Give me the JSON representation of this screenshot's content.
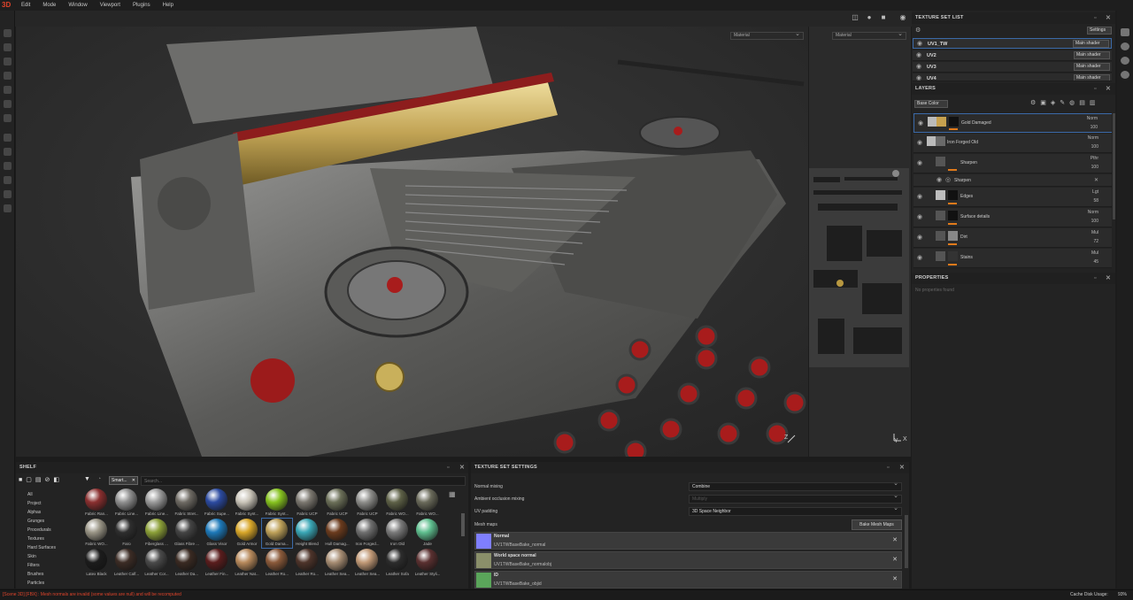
{
  "app": {
    "logo": "3D"
  },
  "menu": [
    "Edit",
    "Mode",
    "Window",
    "Viewport",
    "Plugins",
    "Help"
  ],
  "viewport": {
    "left_dropdown": "Material",
    "right_dropdown": "Material",
    "axis_z": "Z",
    "axis_y": "Y",
    "axis_x": "X"
  },
  "texture_set_list": {
    "title": "TEXTURE SET LIST",
    "settings_label": "Settings",
    "rows": [
      {
        "name": "UV1_TW",
        "shader": "Main shader"
      },
      {
        "name": "UV2",
        "shader": "Main shader"
      },
      {
        "name": "UV3",
        "shader": "Main shader"
      },
      {
        "name": "UV4",
        "shader": "Main shader"
      }
    ]
  },
  "layers": {
    "title": "LAYERS",
    "channel": "Base Color",
    "rows": [
      {
        "name": "Gold Damaged",
        "blend": "Norm",
        "opacity": "100"
      },
      {
        "name": "Iron Forged Old",
        "blend": "Norm",
        "opacity": "100"
      },
      {
        "name": "Sharpen",
        "blend": "Pthr",
        "opacity": "100"
      },
      {
        "name": "Sharpen",
        "blend": "",
        "opacity": ""
      },
      {
        "name": "Edges",
        "blend": "Lgt",
        "opacity": "58"
      },
      {
        "name": "Surface details",
        "blend": "Norm",
        "opacity": "100"
      },
      {
        "name": "Dirt",
        "blend": "Mul",
        "opacity": "72"
      },
      {
        "name": "Stains",
        "blend": "Mul",
        "opacity": "45"
      }
    ]
  },
  "properties": {
    "title": "PROPERTIES",
    "empty_text": "No properties found"
  },
  "shelf": {
    "title": "SHELF",
    "filter_tag": "Smart...",
    "search_placeholder": "Search...",
    "categories": [
      "All",
      "Project",
      "Alphas",
      "Grunges",
      "Procedurals",
      "Textures",
      "Hard Surfaces",
      "Skin",
      "Filters",
      "Brushes",
      "Particles"
    ],
    "materials": [
      {
        "label": "Fabric Ran...",
        "color": "#8a2f2f"
      },
      {
        "label": "Fabric Line...",
        "color": "#8f8f8f"
      },
      {
        "label": "Fabric Line...",
        "color": "#9a9a9a"
      },
      {
        "label": "Fabric Stret...",
        "color": "#6e6a63"
      },
      {
        "label": "Fabric Supe...",
        "color": "#2b4aa0"
      },
      {
        "label": "Fabric Synt...",
        "color": "#c9c4b8"
      },
      {
        "label": "Fabric Synt...",
        "color": "#86c21f"
      },
      {
        "label": "Fabric UCP",
        "color": "#7b776f"
      },
      {
        "label": "Fabric UCP",
        "color": "#6b6f58"
      },
      {
        "label": "Fabric UCP",
        "color": "#8d8d8a"
      },
      {
        "label": "Fabric WO...",
        "color": "#5e6147"
      },
      {
        "label": "Fabric WO...",
        "color": "#6a6a5a"
      },
      {
        "label": "Fabric WO...",
        "color": "#9a9586"
      },
      {
        "label": "Faro",
        "color": "#2e2e2e"
      },
      {
        "label": "Fiberglass ...",
        "color": "#8ca038"
      },
      {
        "label": "Glass Fibre ...",
        "color": "#444444"
      },
      {
        "label": "Glass Visor",
        "color": "#1d79b9"
      },
      {
        "label": "Gold Armor",
        "color": "#d9a729"
      },
      {
        "label": "Gold Dama...",
        "color": "#bfa25a"
      },
      {
        "label": "Height Blend",
        "color": "#3aa7b6"
      },
      {
        "label": "Hull Damag...",
        "color": "#6b3b1d"
      },
      {
        "label": "Iron Forged...",
        "color": "#6f6f6f"
      },
      {
        "label": "Iron Old",
        "color": "#7a7a7a"
      },
      {
        "label": "Jade",
        "color": "#5fbf8f"
      },
      {
        "label": "Latex Black",
        "color": "#1c1c1c"
      },
      {
        "label": "Leather Calf...",
        "color": "#3c2c25"
      },
      {
        "label": "Leather Cor...",
        "color": "#4a4a4a"
      },
      {
        "label": "Leather Da...",
        "color": "#3a2a22"
      },
      {
        "label": "Leather Fin...",
        "color": "#5a1d1d"
      },
      {
        "label": "Leather Nat...",
        "color": "#b88a5c"
      },
      {
        "label": "Leather Ro...",
        "color": "#8b5a3a"
      },
      {
        "label": "Leather Ro...",
        "color": "#4e342a"
      },
      {
        "label": "Leather Sea...",
        "color": "#a78d73"
      },
      {
        "label": "Leather Sea...",
        "color": "#c29a77"
      },
      {
        "label": "Leather Sofa",
        "color": "#2c2c2c"
      },
      {
        "label": "Leather Styli...",
        "color": "#5a3030"
      }
    ]
  },
  "texture_set_settings": {
    "title": "TEXTURE SET SETTINGS",
    "normal_mixing_label": "Normal mixing",
    "normal_mixing_value": "Combine",
    "ao_mixing_label": "Ambient occlusion mixing",
    "ao_mixing_value": "Multiply",
    "uv_padding_label": "UV padding",
    "uv_padding_value": "3D Space Neighbor",
    "mesh_maps_label": "Mesh maps",
    "bake_button": "Bake Mesh Maps",
    "maps": [
      {
        "name": "Normal",
        "file": "UV1TWBaseBake_normal",
        "color": "#7f7fff"
      },
      {
        "name": "World space normal",
        "file": "UV1TWBaseBake_normalobj",
        "color": "#8a8f6a"
      },
      {
        "name": "ID",
        "file": "UV1TWBaseBake_objid",
        "color": "#5aa55a"
      }
    ]
  },
  "status": {
    "message": "[Scene 3D] [FBX] : Mesh normals are invalid (some values are null) and will be recomputed",
    "cache_label": "Cache Disk Usage:",
    "cache_value": "93%",
    "message_color": "#e0442b"
  }
}
